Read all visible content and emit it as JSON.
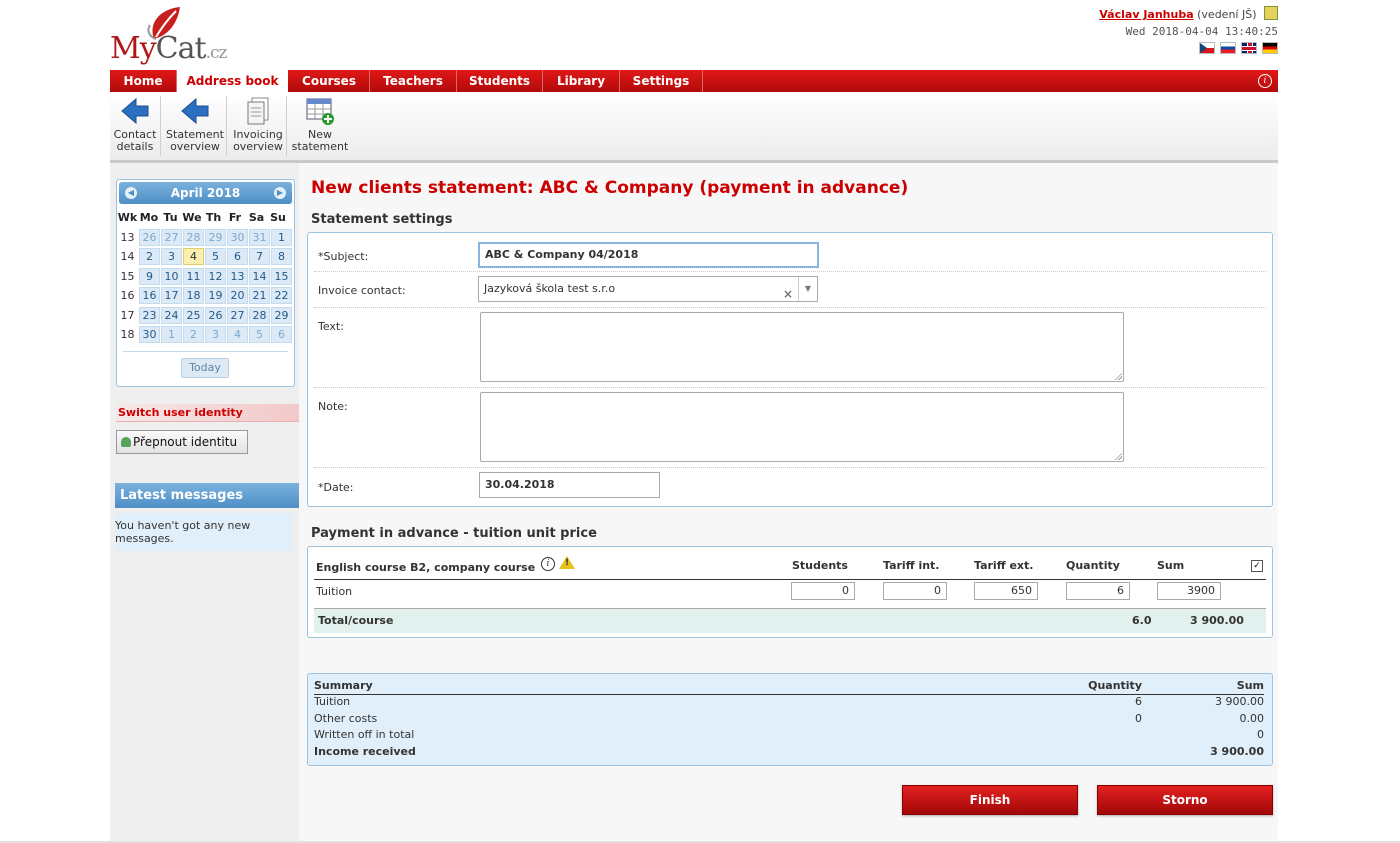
{
  "header": {
    "logo_my": "My",
    "logo_cat": "Cat",
    "logo_cz": ".cz",
    "user_name": "Václav Janhuba",
    "user_role": "(vedení JŠ)",
    "datetime": "Wed 2018-04-04 13:40:25",
    "flags": [
      "cz-flag",
      "sk-flag",
      "gb-flag",
      "de-flag"
    ]
  },
  "nav": {
    "items": [
      "Home",
      "Address book",
      "Courses",
      "Teachers",
      "Students",
      "Library",
      "Settings"
    ],
    "active": "Address book",
    "info_icon": "i"
  },
  "toolbar": {
    "contact_details": [
      "Contact",
      "details"
    ],
    "statement_overview": [
      "Statement",
      "overview"
    ],
    "invoicing_overview": [
      "Invoicing",
      "overview"
    ],
    "new_statement": [
      "New",
      "statement"
    ]
  },
  "calendar": {
    "month": "April 2018",
    "headers": [
      "Wk",
      "Mo",
      "Tu",
      "We",
      "Th",
      "Fr",
      "Sa",
      "Su"
    ],
    "weeks": [
      {
        "wk": "13",
        "days": [
          "26",
          "27",
          "28",
          "29",
          "30",
          "31",
          "1"
        ]
      },
      {
        "wk": "14",
        "days": [
          "2",
          "3",
          "4",
          "5",
          "6",
          "7",
          "8"
        ]
      },
      {
        "wk": "15",
        "days": [
          "9",
          "10",
          "11",
          "12",
          "13",
          "14",
          "15"
        ]
      },
      {
        "wk": "16",
        "days": [
          "16",
          "17",
          "18",
          "19",
          "20",
          "21",
          "22"
        ]
      },
      {
        "wk": "17",
        "days": [
          "23",
          "24",
          "25",
          "26",
          "27",
          "28",
          "29"
        ]
      },
      {
        "wk": "18",
        "days": [
          "30",
          "1",
          "2",
          "3",
          "4",
          "5",
          "6"
        ]
      }
    ],
    "today_day": "4",
    "today_button": "Today"
  },
  "sidebar": {
    "switch_title": "Switch user identity",
    "switch_button": "Přepnout identitu",
    "messages_title": "Latest messages",
    "messages_body": "You haven't got any new messages."
  },
  "main": {
    "title": "New clients statement: ABC & Company (payment in advance)",
    "settings_title": "Statement settings",
    "subject_label": "*Subject:",
    "subject_value": "ABC & Company 04/2018",
    "invoice_label": "Invoice contact:",
    "invoice_value": "Jazyková škola test s.r.o",
    "text_label": "Text:",
    "note_label": "Note:",
    "date_label": "*Date:",
    "date_value": "30.04.2018"
  },
  "payment": {
    "title": "Payment in advance - tuition unit price",
    "course": "English course B2, company course",
    "columns": [
      "Students",
      "Tariff int.",
      "Tariff ext.",
      "Quantity",
      "Sum"
    ],
    "row_label": "Tuition",
    "values": [
      "0",
      "0",
      "650",
      "6",
      "3900"
    ],
    "total_label": "Total/course",
    "total_quantity": "6.0",
    "total_sum": "3 900.00"
  },
  "summary": {
    "heading": "Summary",
    "col_quantity": "Quantity",
    "col_sum": "Sum",
    "rows": [
      {
        "label": "Tuition",
        "quantity": "6",
        "sum": "3 900.00"
      },
      {
        "label": "Other costs",
        "quantity": "0",
        "sum": "0.00"
      },
      {
        "label": "Written off in total",
        "quantity": "",
        "sum": "0"
      },
      {
        "label": "Income received",
        "quantity": "",
        "sum": "3 900.00"
      }
    ]
  },
  "buttons": {
    "finish": "Finish",
    "storno": "Storno"
  }
}
